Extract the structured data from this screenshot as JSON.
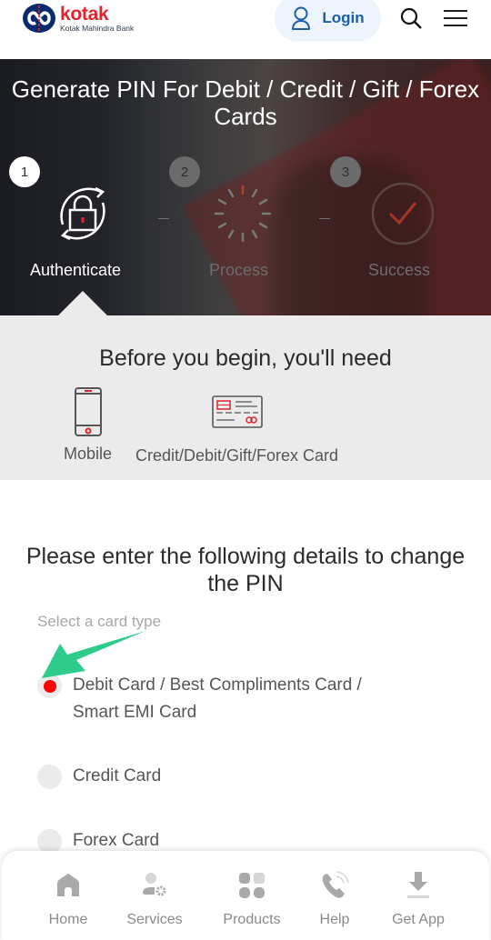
{
  "header": {
    "logo_brand": "kotak",
    "logo_subtitle": "Kotak Mahindra Bank",
    "login_label": "Login",
    "brand_color": "#e3222d",
    "login_color": "#1a5ea8"
  },
  "hero": {
    "title": "Generate PIN For Debit / Credit / Gift / Forex Cards",
    "steps": [
      {
        "number": "1",
        "label": "Authenticate",
        "icon": "lock-refresh-icon",
        "state": "active"
      },
      {
        "number": "2",
        "label": "Process",
        "icon": "spinner-icon",
        "state": "inactive"
      },
      {
        "number": "3",
        "label": "Success",
        "icon": "check-circle-icon",
        "state": "inactive"
      }
    ],
    "separator": "--"
  },
  "requirements": {
    "title": "Before you begin, you'll need",
    "items": [
      {
        "label": "Mobile",
        "icon": "mobile-phone-icon"
      },
      {
        "label": "Credit/Debit/Gift/Forex Card",
        "icon": "credit-card-icon"
      }
    ]
  },
  "form": {
    "title": "Please enter the following details to change the PIN",
    "select_label": "Select a card type",
    "card_types": [
      {
        "label": "Debit Card / Best Compliments Card / Smart EMI Card",
        "selected": true
      },
      {
        "label": "Credit Card",
        "selected": false
      },
      {
        "label": "Forex Card",
        "selected": false
      }
    ],
    "selected_color": "#ff0000",
    "annotation_arrow_color": "#2ecc8a"
  },
  "bottom_nav": {
    "items": [
      {
        "label": "Home",
        "icon": "home-icon"
      },
      {
        "label": "Services",
        "icon": "user-gear-icon"
      },
      {
        "label": "Products",
        "icon": "grid-icon"
      },
      {
        "label": "Help",
        "icon": "phone-call-icon"
      },
      {
        "label": "Get App",
        "icon": "download-icon"
      }
    ]
  }
}
